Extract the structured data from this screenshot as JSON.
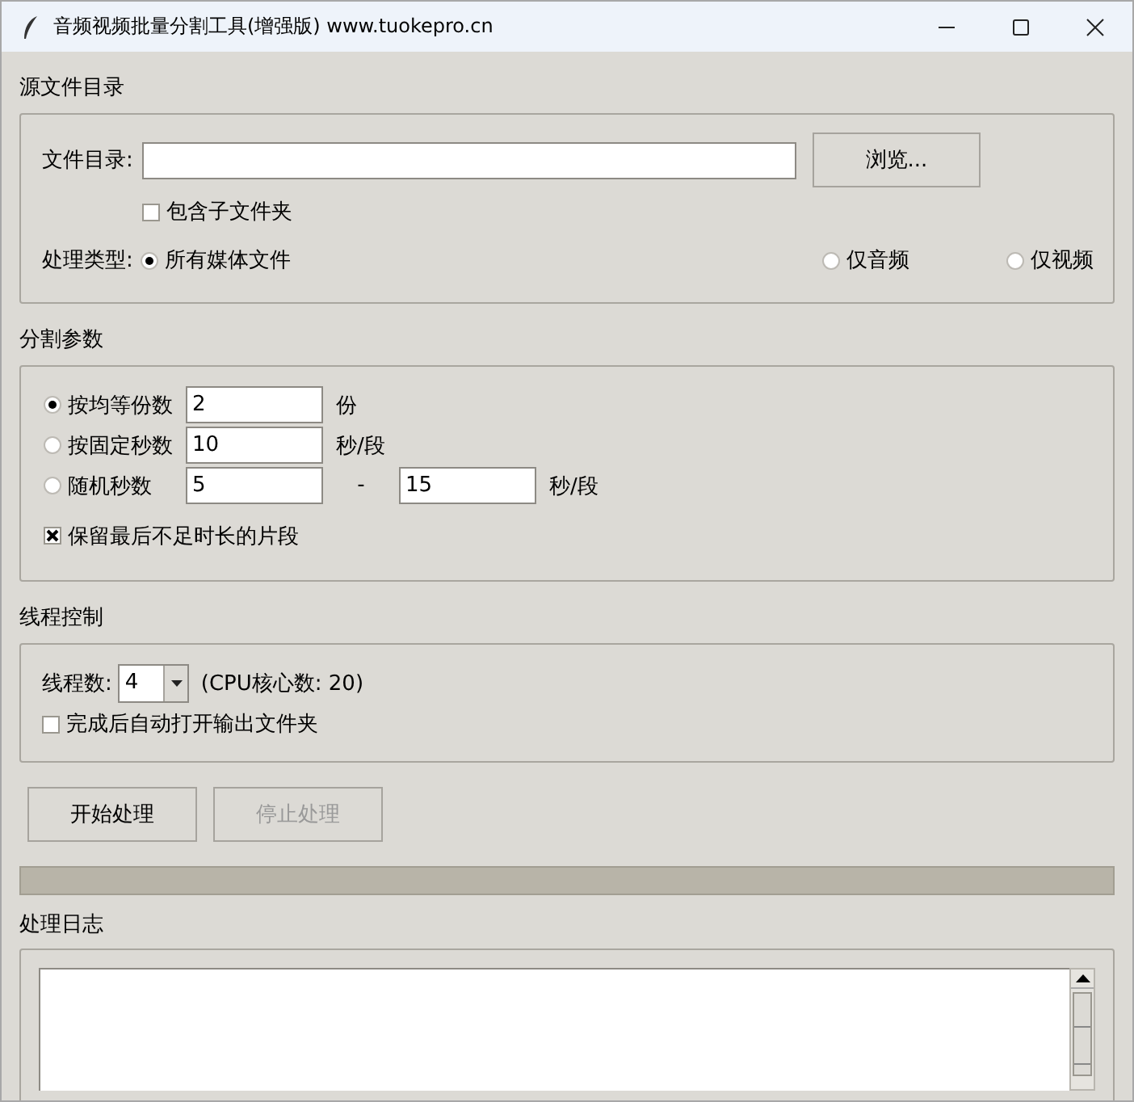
{
  "window": {
    "title": "音频视频批量分割工具(增强版) www.tuokepro.cn"
  },
  "source": {
    "heading": "源文件目录",
    "dir_label": "文件目录:",
    "browse_button": "浏览...",
    "include_subfolders": {
      "label": "包含子文件夹",
      "checked": false
    },
    "type_label": "处理类型:",
    "types": [
      {
        "label": "所有媒体文件",
        "selected": true
      },
      {
        "label": "仅音频",
        "selected": false
      },
      {
        "label": "仅视频",
        "selected": false
      }
    ]
  },
  "split": {
    "heading": "分割参数",
    "modes": [
      {
        "label": "按均等份数",
        "selected": true,
        "values": [
          "2"
        ],
        "unit": "份"
      },
      {
        "label": "按固定秒数",
        "selected": false,
        "values": [
          "10"
        ],
        "unit": "秒/段"
      },
      {
        "label": "随机秒数",
        "selected": false,
        "values": [
          "5",
          "15"
        ],
        "separator": "-",
        "unit": "秒/段"
      }
    ],
    "keep_last": {
      "label": "保留最后不足时长的片段",
      "checked": true
    }
  },
  "threads": {
    "heading": "线程控制",
    "label": "线程数:",
    "value": "4",
    "cpu_info": "(CPU核心数: 20)",
    "open_output": {
      "label": "完成后自动打开输出文件夹",
      "checked": false
    }
  },
  "actions": [
    {
      "label": "开始处理",
      "disabled": false
    },
    {
      "label": "停止处理",
      "disabled": true
    }
  ],
  "progress": {
    "level": 0
  },
  "log": {
    "heading": "处理日志"
  }
}
